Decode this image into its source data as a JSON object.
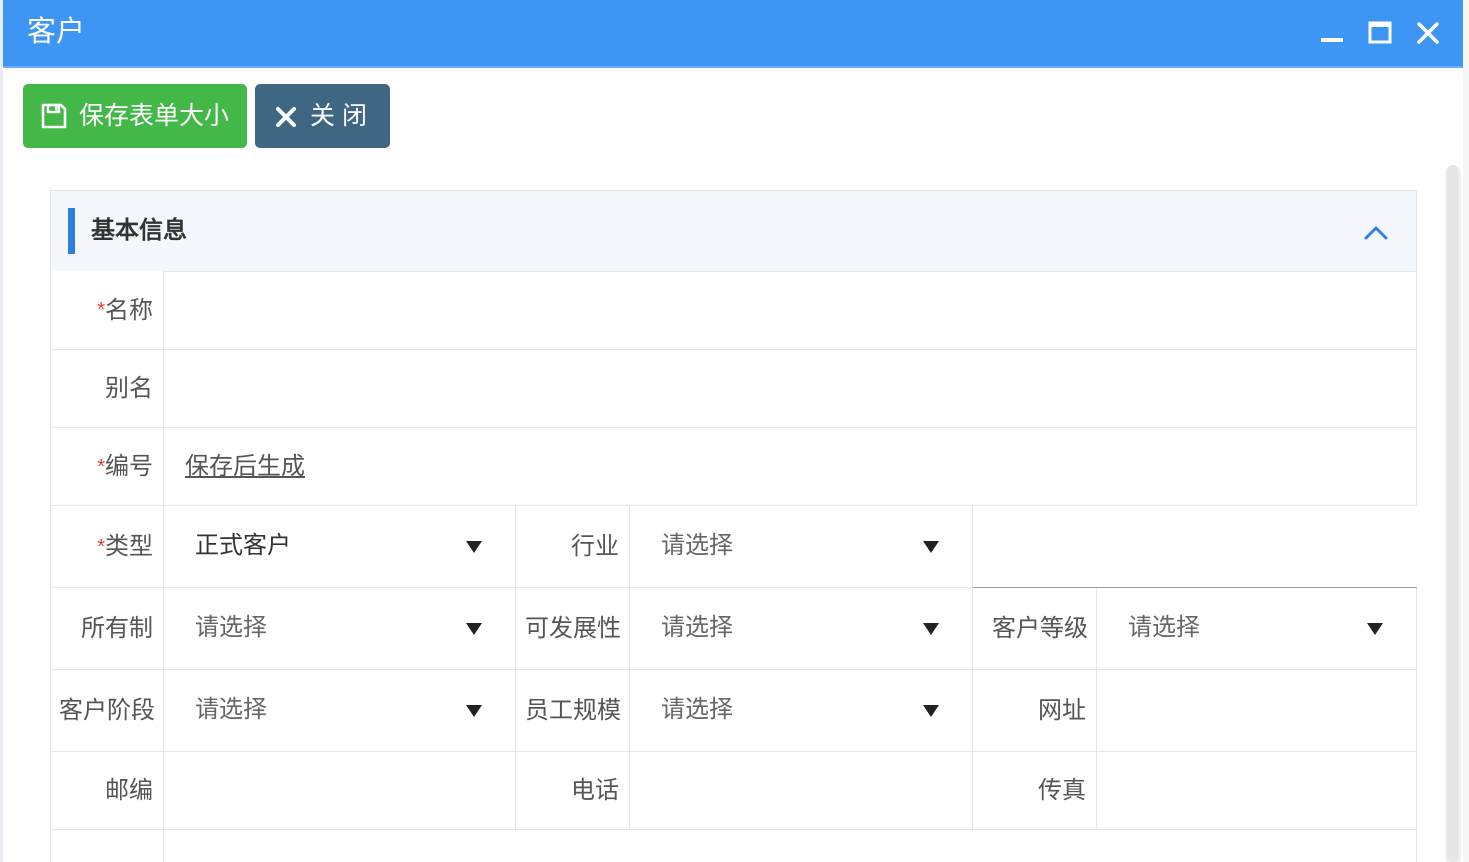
{
  "window": {
    "title": "客户",
    "controls": [
      "minimize-icon",
      "maximize-icon",
      "close-icon"
    ]
  },
  "toolbar": {
    "save_label": "保存表单大小",
    "close_label": "关 闭"
  },
  "section": {
    "title": "基本信息"
  },
  "fields": {
    "name_label": "名称",
    "alias_label": "别名",
    "code_label": "编号",
    "code_value": "保存后生成",
    "type_label": "类型",
    "type_value": "正式客户",
    "industry_label": "行业",
    "industry_value": "请选择",
    "ownership_label": "所有制",
    "ownership_value": "请选择",
    "potential_label": "可发展性",
    "potential_value": "请选择",
    "level_label": "客户等级",
    "level_value": "请选择",
    "stage_label": "客户阶段",
    "stage_value": "请选择",
    "staff_label": "员工规模",
    "staff_value": "请选择",
    "website_label": "网址",
    "zip_label": "邮编",
    "phone_label": "电话",
    "fax_label": "传真"
  },
  "required_mark": "*",
  "colors": {
    "titlebar": "#3d95f4",
    "save_button": "#43b849",
    "close_button": "#3f6783",
    "accent_bar": "#2e7fe0",
    "required": "#e23b2b"
  }
}
